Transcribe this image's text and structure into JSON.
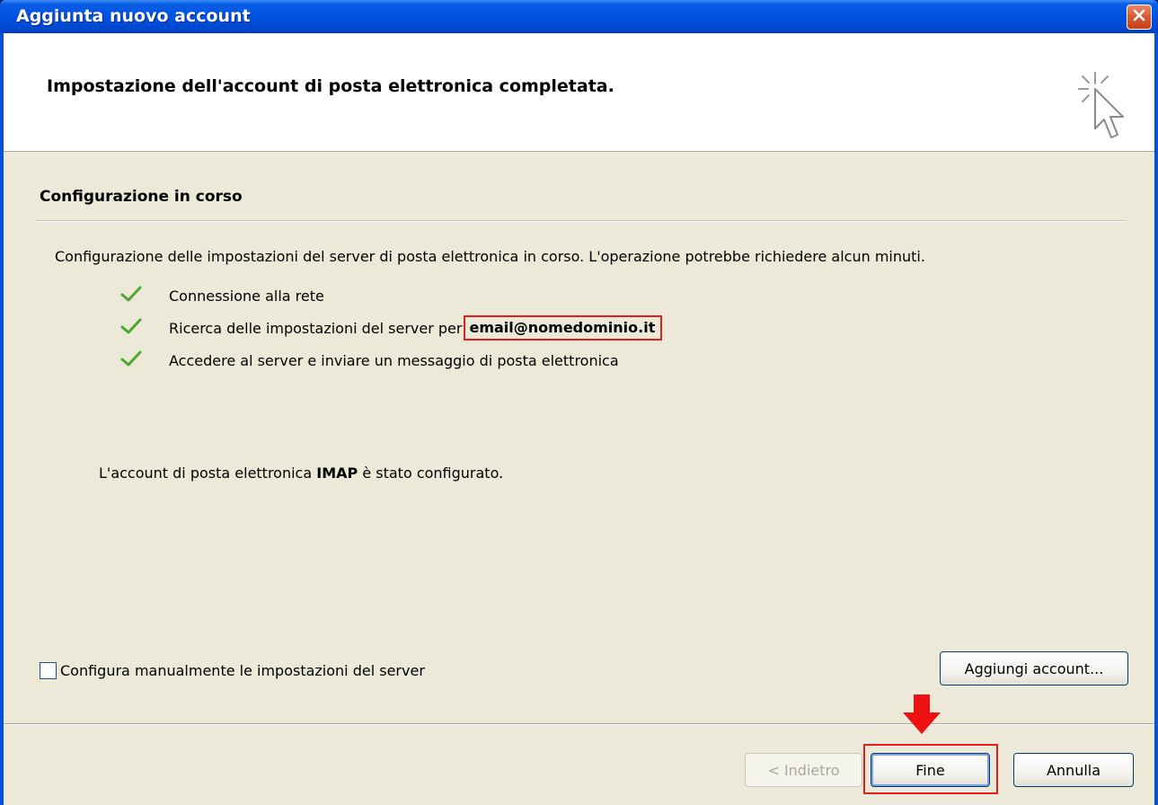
{
  "window": {
    "title": "Aggiunta nuovo account",
    "close_icon": "close-icon"
  },
  "header": {
    "title": "Impostazione dell'account di posta elettronica completata.",
    "icon": "wizard-cursor-icon"
  },
  "section": {
    "title": "Configurazione in corso",
    "description": "Configurazione delle impostazioni del server di posta elettronica in corso. L'operazione potrebbe richiedere alcun minuti."
  },
  "steps": [
    {
      "label": "Connessione alla rete",
      "status": "done"
    },
    {
      "label": "Ricerca delle impostazioni del server per",
      "email": "email@nomedominio.it",
      "status": "done"
    },
    {
      "label": "Accedere al server e inviare un messaggio di posta elettronica",
      "status": "done"
    }
  ],
  "result": {
    "prefix": "L'account di posta elettronica ",
    "protocol": "IMAP",
    "suffix": " è stato configurato."
  },
  "options": {
    "manual_config_label": "Configura manualmente le impostazioni del server",
    "manual_config_checked": false
  },
  "buttons": {
    "add_account": "Aggiungi account...",
    "back": "< Indietro",
    "finish": "Fine",
    "cancel": "Annulla"
  },
  "colors": {
    "check_green": "#4aa832",
    "highlight_red": "#e0201c",
    "titlebar_blue": "#0054e3"
  }
}
